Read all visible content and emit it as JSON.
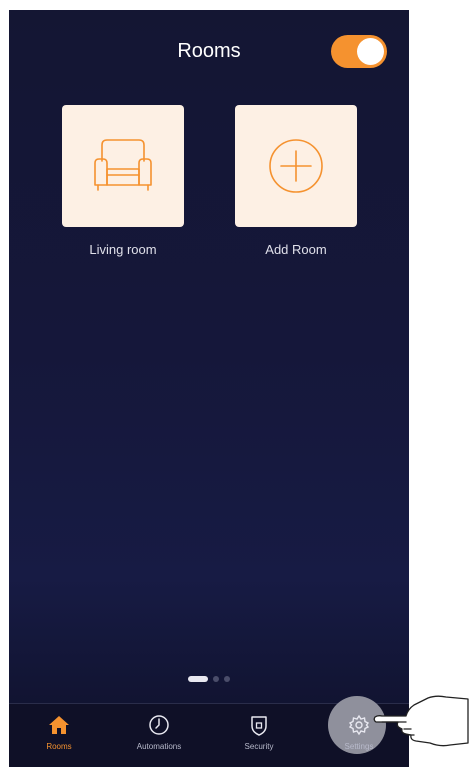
{
  "header": {
    "title": "Rooms",
    "toggle_on": true
  },
  "rooms": [
    {
      "label": "Living room",
      "icon": "armchair-icon"
    },
    {
      "label": "Add Room",
      "icon": "plus-circle-icon"
    }
  ],
  "pager": {
    "pages": 3,
    "active": 0
  },
  "tabs": [
    {
      "label": "Rooms",
      "icon": "home-icon",
      "active": true
    },
    {
      "label": "Automations",
      "icon": "clock-icon",
      "active": false
    },
    {
      "label": "Security",
      "icon": "shield-icon",
      "active": false
    },
    {
      "label": "Settings",
      "icon": "gear-icon",
      "active": false
    }
  ],
  "colors": {
    "accent": "#f5922f",
    "background": "#15173a",
    "tile": "#fdf0e4"
  }
}
